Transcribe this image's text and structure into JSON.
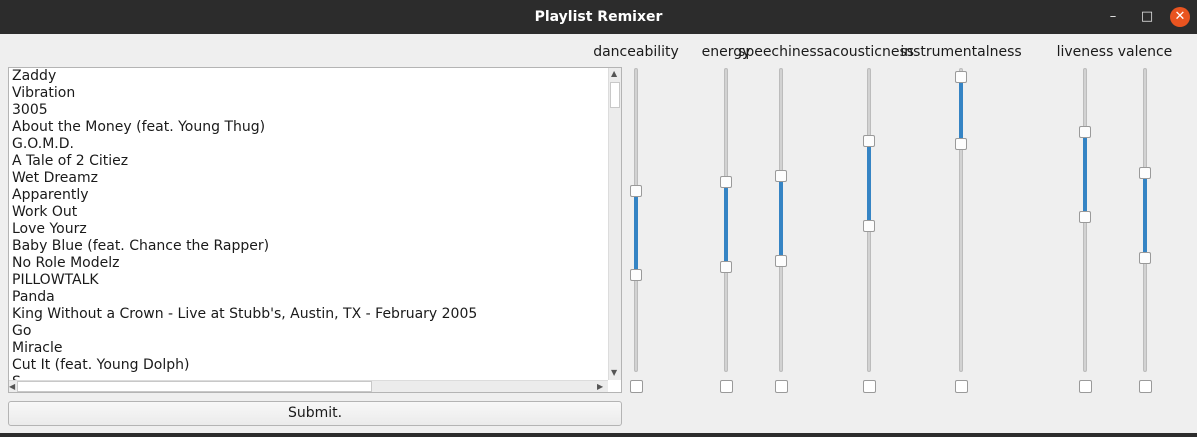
{
  "window": {
    "title": "Playlist Remixer",
    "minimize_glyph": "–",
    "maximize_glyph": "□",
    "close_glyph": "✕"
  },
  "songs": [
    "Zaddy",
    "Vibration",
    "3005",
    "About the Money (feat. Young Thug)",
    "G.O.M.D.",
    "A Tale of 2 Citiez",
    "Wet Dreamz",
    "Apparently",
    "Work Out",
    "Love Yourz",
    "Baby Blue (feat. Chance the Rapper)",
    "No Role Modelz",
    "PILLOWTALK",
    "Panda",
    "King Without a Crown - Live at Stubb's, Austin, TX - February 2005",
    "Go",
    "Miracle",
    "Cut It (feat. Young Dolph)",
    "S..."
  ],
  "submit_label": "Submit.",
  "features": [
    {
      "name": "danceability",
      "low": 0.31,
      "high": 0.6
    },
    {
      "name": "energy",
      "low": 0.34,
      "high": 0.63
    },
    {
      "name": "speechiness",
      "low": 0.36,
      "high": 0.65
    },
    {
      "name": "acousticness",
      "low": 0.48,
      "high": 0.77
    },
    {
      "name": "instrumentalness",
      "low": 0.76,
      "high": 0.99
    },
    {
      "name": "liveness",
      "low": 0.51,
      "high": 0.8
    },
    {
      "name": "valence",
      "low": 0.37,
      "high": 0.66
    }
  ],
  "colors": {
    "accent": "#3584c4",
    "close": "#e95420",
    "titlebar": "#2c2c2c"
  }
}
